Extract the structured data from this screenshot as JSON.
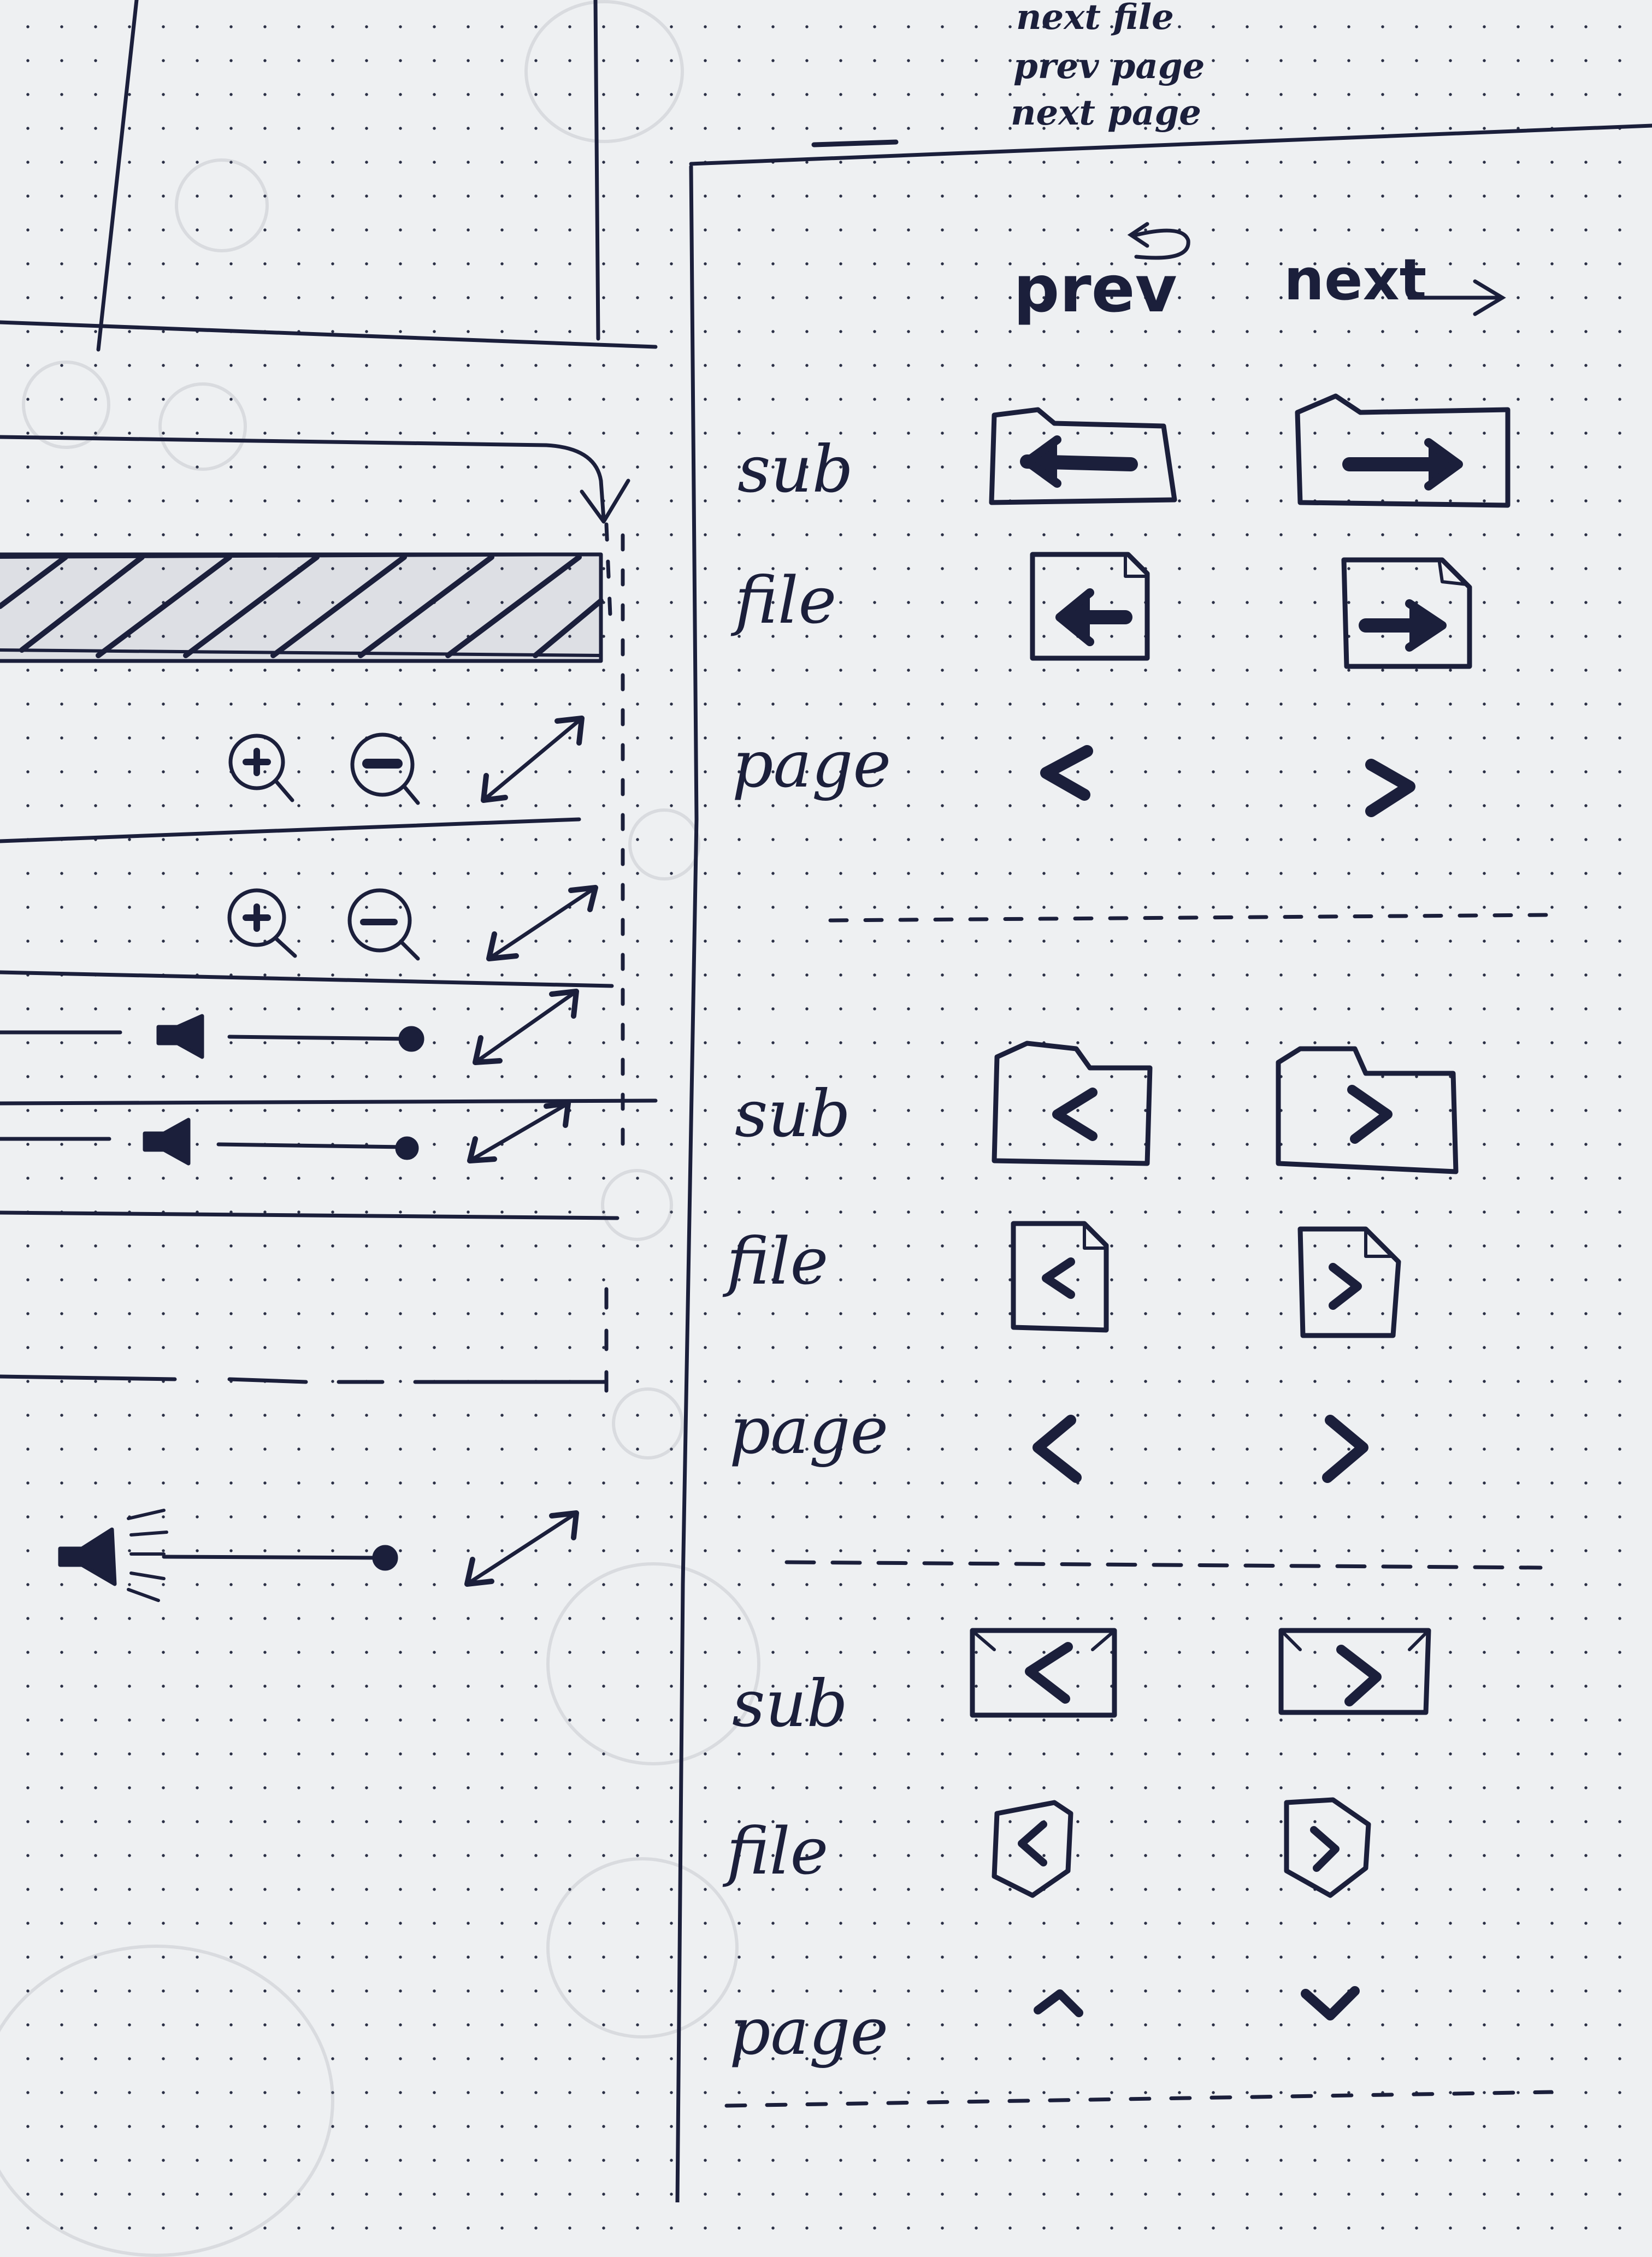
{
  "notes": [
    "next file",
    "prev page",
    "next page"
  ],
  "columns": {
    "prev": "prev",
    "next": "next"
  },
  "groups": [
    {
      "style": "bold arrows",
      "rows": [
        {
          "label": "sub",
          "prev_icon": "folder-left-arrow-icon",
          "next_icon": "folder-right-arrow-icon"
        },
        {
          "label": "file",
          "prev_icon": "file-left-arrow-icon",
          "next_icon": "file-right-arrow-icon"
        },
        {
          "label": "page",
          "prev_icon": "chevron-left-icon",
          "next_icon": "chevron-right-icon"
        }
      ]
    },
    {
      "style": "chevrons",
      "rows": [
        {
          "label": "sub",
          "prev_icon": "folder-chevron-left-icon",
          "next_icon": "folder-chevron-right-icon"
        },
        {
          "label": "file",
          "prev_icon": "file-chevron-left-icon",
          "next_icon": "file-chevron-right-icon"
        },
        {
          "label": "page",
          "prev_icon": "chevron-left-icon",
          "next_icon": "chevron-right-icon"
        }
      ]
    },
    {
      "style": "compact",
      "rows": [
        {
          "label": "sub",
          "prev_icon": "envelope-chevron-left-icon",
          "next_icon": "envelope-chevron-right-icon"
        },
        {
          "label": "file",
          "prev_icon": "tag-chevron-left-icon",
          "next_icon": "tag-chevron-right-icon"
        },
        {
          "label": "page",
          "prev_icon": "chevron-up-icon",
          "next_icon": "chevron-down-icon"
        }
      ]
    }
  ],
  "left_panel": {
    "icons": [
      "zoom-in-icon",
      "zoom-out-icon",
      "expand-arrows-icon",
      "speaker-icon",
      "volume-slider",
      "speaker-loud-icon"
    ]
  },
  "colors": {
    "ink": "#1b1f3b",
    "paper": "#eef0f2"
  }
}
